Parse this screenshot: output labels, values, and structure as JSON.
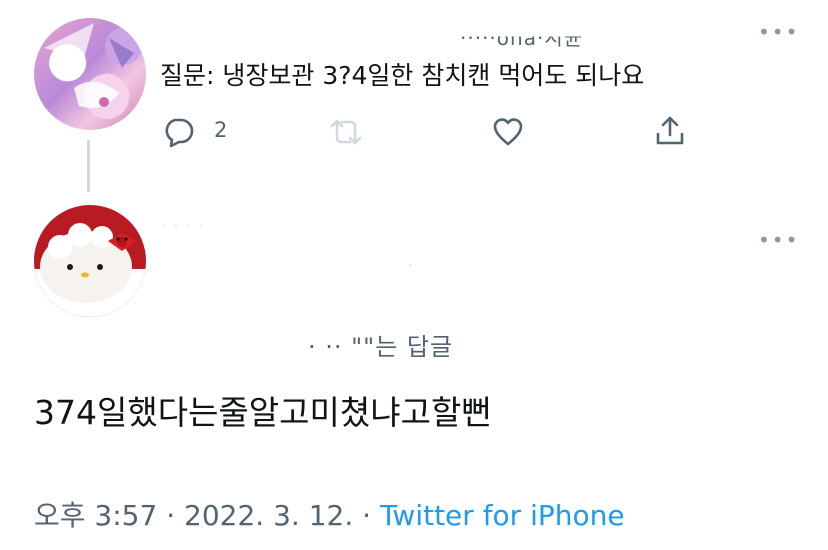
{
  "tweet": {
    "author_name": "·····ona·시균",
    "text": "질문: 냉장보관 3?4일한 참치캔 먹어도 되나요",
    "more_label": "•••",
    "reply_count": "2"
  },
  "reply": {
    "author_name": "· ·  · ·",
    "handle": "·",
    "more_label": "•••",
    "context": "· ·· \"\"는 답글",
    "text": "374일했다는줄알고미쳤냐고할뻔"
  },
  "meta": {
    "time": "오후 3:57",
    "separator": "·",
    "date": "2022. 3. 12.",
    "source": "Twitter for iPhone"
  },
  "colors": {
    "text": "#0f1419",
    "secondary": "#536471",
    "link": "#1d9bf0",
    "thread_line": "#cfd9de"
  }
}
